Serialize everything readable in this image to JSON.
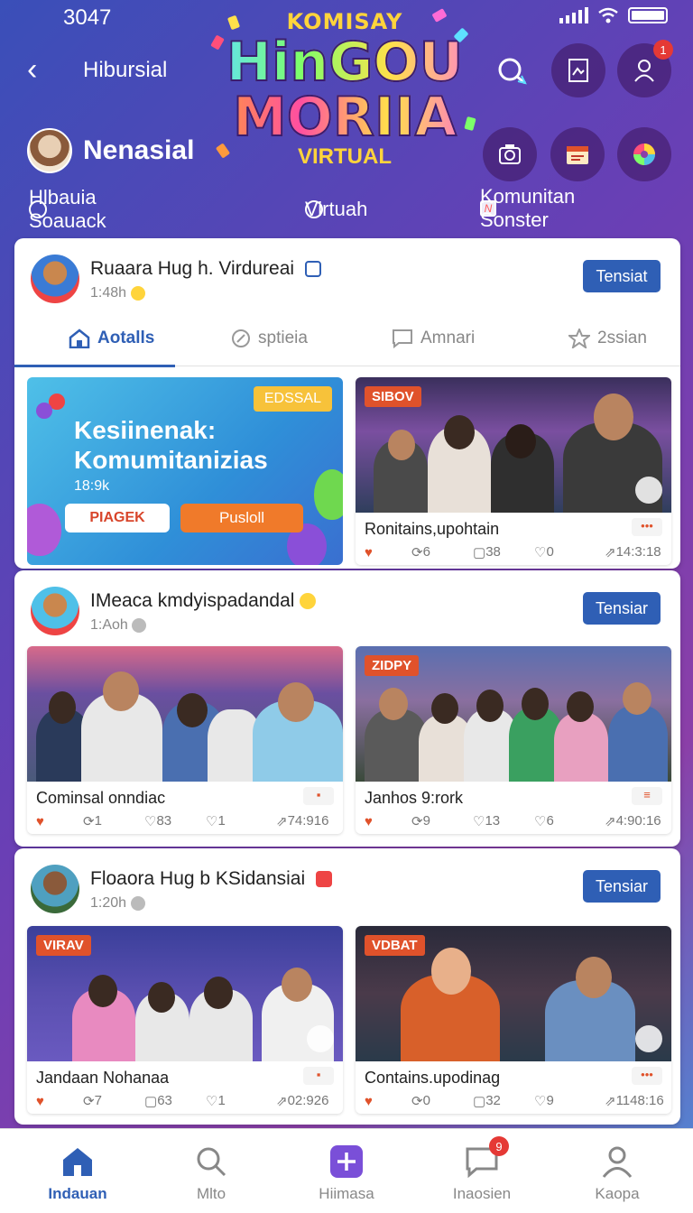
{
  "status": {
    "time": "3047"
  },
  "header": {
    "back_label": "‹",
    "title": "Hibursial",
    "logo": {
      "line1": "KOMISAY",
      "line2": "HinGOU",
      "line3": "MORIIA",
      "line4": "VIRTUAL"
    },
    "notif_count": "1"
  },
  "profile": {
    "name": "Nenasial"
  },
  "subnav": {
    "left": "Hlbauia Soauack",
    "center": "Virtuah",
    "right": "Komunitan Sonster",
    "right_badge": "N"
  },
  "posts": [
    {
      "name": "Ruaara Hug h. Virdureai",
      "time": "1:48h",
      "button": "Tensiat",
      "tabs": [
        "Aotalls",
        "sptieia",
        "Amnari",
        "2ssian"
      ],
      "promo": {
        "tag": "EDSSAL",
        "title": "Kesiinenak: Komumitanizias",
        "sub": "18:9k",
        "btn1": "PIAGEK",
        "btn2": "Pusloll"
      },
      "tile": {
        "tag": "SIBOV",
        "caption": "Ronitains,upohtain",
        "stats": [
          "6",
          "38",
          "0",
          "14:3:18"
        ],
        "more": "•••"
      }
    },
    {
      "name": "IMeaca kmdyispadandal",
      "time": "1:Aoh",
      "button": "Tensiar",
      "tiles": [
        {
          "caption": "Cominsal onndiac",
          "stats": [
            "1",
            "83",
            "1",
            "74:916"
          ]
        },
        {
          "tag": "ZIDPY",
          "caption": "Janhos 9:rork",
          "stats": [
            "9",
            "13",
            "6",
            "4:90:16"
          ]
        }
      ]
    },
    {
      "name": "Floaora Hug b KSidansiai",
      "time": "1:20h",
      "button": "Tensiar",
      "tiles": [
        {
          "tag": "VIRAV",
          "caption": "Jandaan Nohanaa",
          "stats": [
            "7",
            "63",
            "1",
            "02:926"
          ]
        },
        {
          "tag": "VDBAT",
          "caption": "Contains.upodinag",
          "stats": [
            "0",
            "32",
            "9",
            "1148:16"
          ],
          "more": "•••"
        }
      ]
    }
  ],
  "bottom_nav": [
    {
      "label": "Indauan",
      "icon": "home-icon"
    },
    {
      "label": "Mlto",
      "icon": "search-people-icon"
    },
    {
      "label": "Hiimasa",
      "icon": "plus-icon"
    },
    {
      "label": "Inaosien",
      "icon": "chat-icon",
      "badge": "9"
    },
    {
      "label": "Kaopa",
      "icon": "profile-icon"
    }
  ],
  "colors": {
    "accent": "#2f5fb5",
    "tag": "#e0522b",
    "header_gradient_start": "#3a4fb8",
    "header_gradient_end": "#8b3fa8"
  }
}
